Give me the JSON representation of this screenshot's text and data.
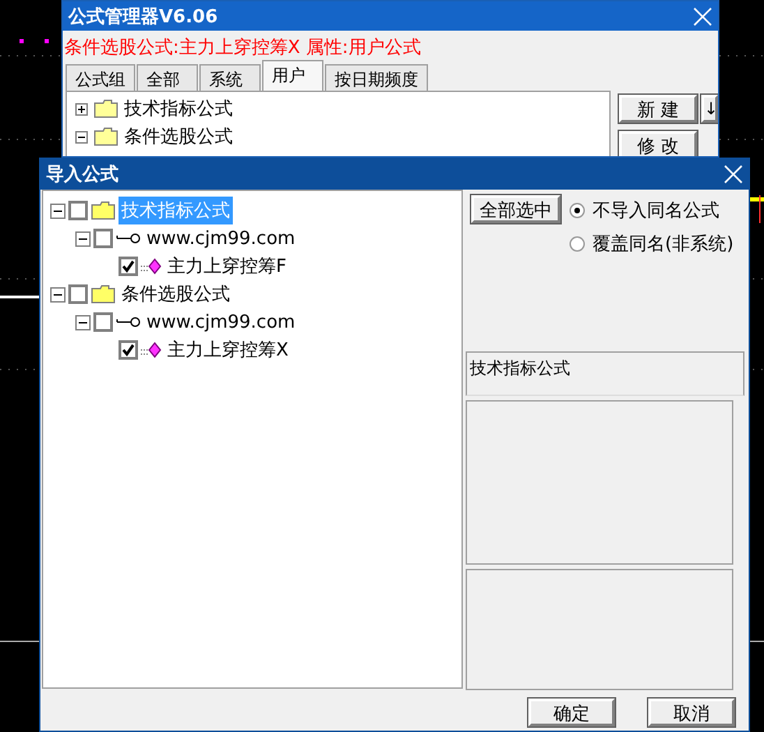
{
  "manager_window": {
    "title": "公式管理器V6.06",
    "info": "条件选股公式:主力上穿控筹X  属性:用户公式",
    "tabs": [
      {
        "label": "公式组",
        "selected": false
      },
      {
        "label": "全部",
        "selected": false
      },
      {
        "label": "系统",
        "selected": false
      },
      {
        "label": "用户",
        "selected": true
      },
      {
        "label": "按日期频度",
        "selected": false
      }
    ],
    "tree": [
      {
        "label": "技术指标公式",
        "expanded": false
      },
      {
        "label": "条件选股公式",
        "expanded": true
      }
    ],
    "buttons": [
      "新 建",
      "修 改"
    ],
    "arrow_button": "↓"
  },
  "import_dialog": {
    "title": "导入公式",
    "tree": [
      {
        "kind": "folder",
        "label": "技术指标公式",
        "checked": false,
        "selected": true,
        "expanded": true,
        "children": [
          {
            "kind": "author",
            "label": "www.cjm99.com",
            "checked": false,
            "selected": false,
            "expanded": true,
            "children": [
              {
                "kind": "formula",
                "label": "主力上穿控筹F",
                "checked": true,
                "selected": false
              }
            ]
          }
        ]
      },
      {
        "kind": "folder",
        "label": "条件选股公式",
        "checked": false,
        "selected": false,
        "expanded": true,
        "children": [
          {
            "kind": "author",
            "label": "www.cjm99.com",
            "checked": false,
            "selected": false,
            "expanded": true,
            "children": [
              {
                "kind": "formula",
                "label": "主力上穿控筹X",
                "checked": true,
                "selected": false
              }
            ]
          }
        ]
      }
    ],
    "select_all_button": "全部选中",
    "options": [
      {
        "label": "不导入同名公式",
        "selected": true
      },
      {
        "label": "覆盖同名(非系统)",
        "selected": false
      }
    ],
    "category": "技术指标公式",
    "buttons": [
      "确定",
      "取消"
    ]
  }
}
